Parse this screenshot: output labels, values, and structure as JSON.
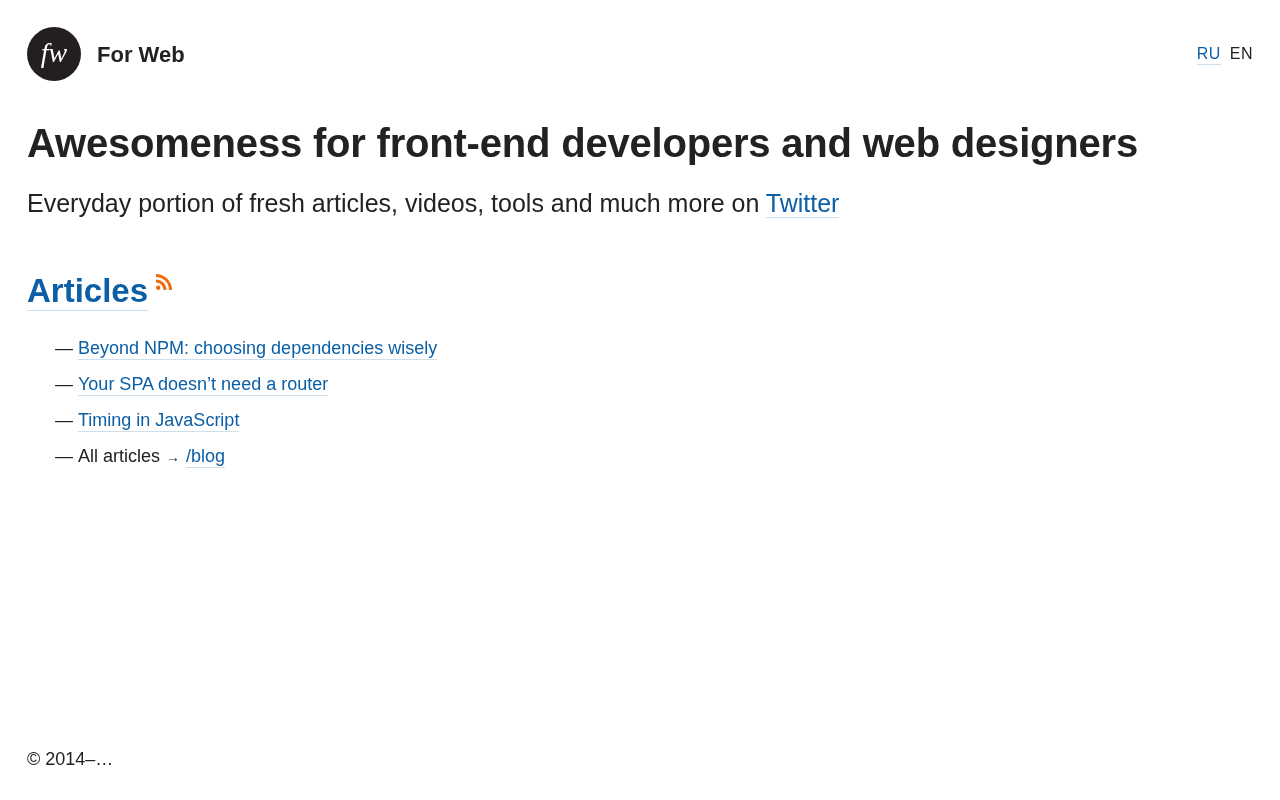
{
  "header": {
    "logo_text": "fw",
    "site_name": "For Web",
    "languages": [
      {
        "label": "RU",
        "selected": false
      },
      {
        "label": "EN",
        "selected": true
      }
    ]
  },
  "hero": {
    "title": "Awesomeness for front-end developers and web designers",
    "subtitle": "Everyday portion of fresh articles, videos, tools and much more on",
    "subtitle_link": "Twitter"
  },
  "articles": {
    "heading": "Articles",
    "items": [
      {
        "kind": "link",
        "dash": "—",
        "text": "Beyond NPM: choosing dependencies wisely"
      },
      {
        "kind": "link",
        "dash": "—",
        "text": "Your SPA doesn’t need a router"
      },
      {
        "kind": "link",
        "dash": "—",
        "text": "Timing in JavaScript"
      },
      {
        "kind": "index",
        "dash": "—",
        "text": "All articles",
        "arrow": "→",
        "link": "/blog"
      }
    ]
  },
  "footer": {
    "copyright": "© 2014–…"
  }
}
